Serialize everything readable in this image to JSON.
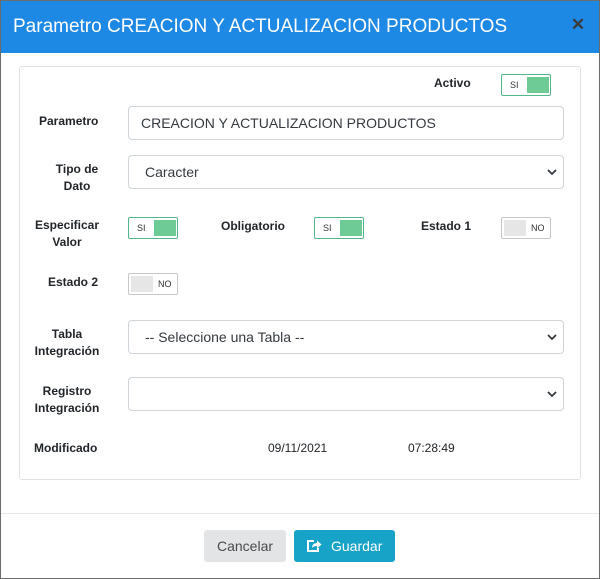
{
  "header": {
    "title": "Parametro CREACION Y ACTUALIZACION PRODUCTOS",
    "close_icon": "close-icon",
    "color": "#1e88e5"
  },
  "form": {
    "activo": {
      "label": "Activo",
      "toggle": "SI",
      "checked": true
    },
    "parametro": {
      "label": "Parametro",
      "value": "CREACION Y ACTUALIZACION PRODUCTOS"
    },
    "tipo_dato": {
      "label_line1": "Tipo de",
      "label_line2": "Dato",
      "selected": "Caracter"
    },
    "especificar_valor": {
      "label_line1": "Especificar",
      "label_line2": "Valor",
      "toggle": "SI",
      "checked": true
    },
    "obligatorio": {
      "label": "Obligatorio",
      "toggle": "SI",
      "checked": true
    },
    "estado1": {
      "label": "Estado 1",
      "toggle": "NO",
      "checked": false
    },
    "estado2": {
      "label": "Estado 2",
      "toggle": "NO",
      "checked": false
    },
    "tabla_integracion": {
      "label_line1": "Tabla",
      "label_line2": "Integración",
      "selected": "-- Seleccione una Tabla --"
    },
    "registro_integracion": {
      "label_line1": "Registro",
      "label_line2": "Integración",
      "selected": ""
    },
    "modificado": {
      "label": "Modificado",
      "date": "09/11/2021",
      "time": "07:28:49"
    }
  },
  "footer": {
    "cancel_label": "Cancelar",
    "save_label": "Guardar",
    "save_icon": "save-share-icon",
    "save_color": "#17a2c8"
  }
}
